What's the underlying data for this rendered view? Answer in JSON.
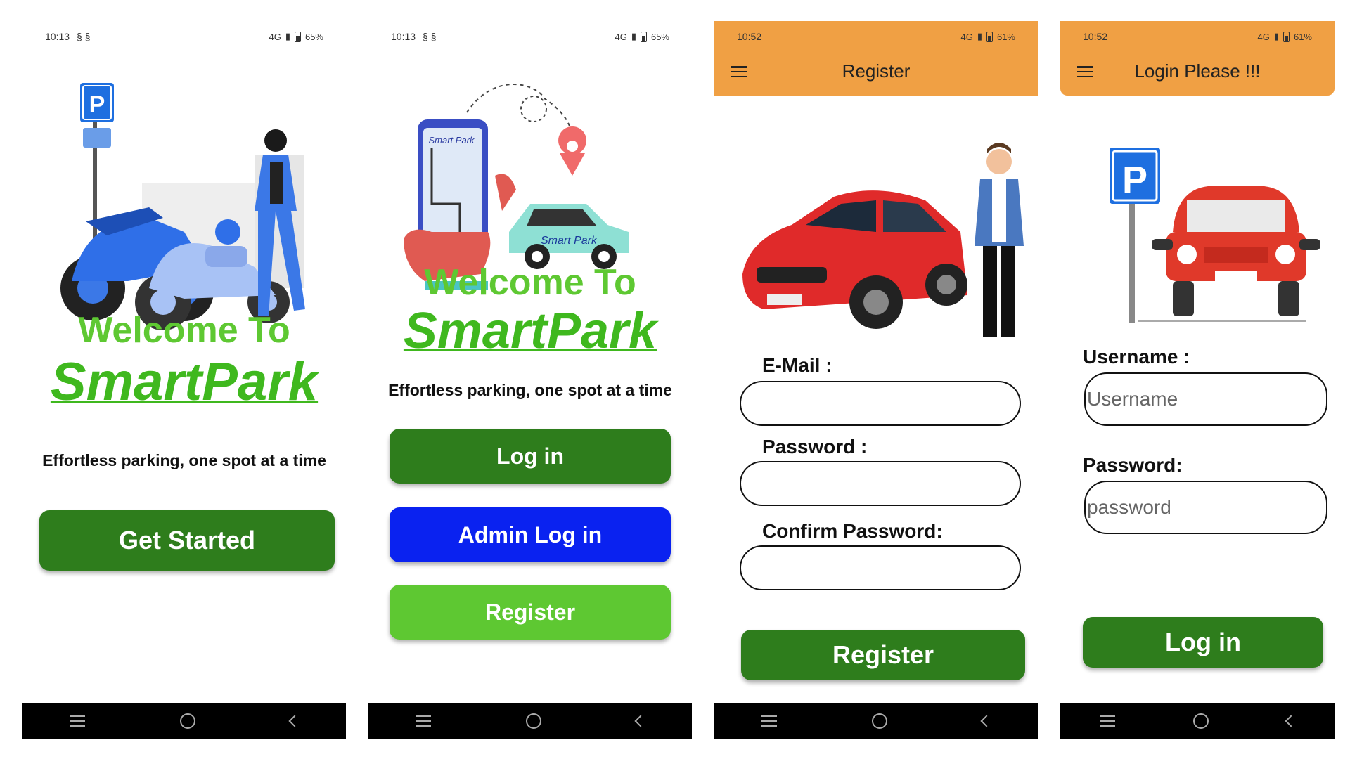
{
  "screens": {
    "welcome": {
      "status": {
        "time": "10:13",
        "right": "4G",
        "battery": "65%"
      },
      "welcome_text": "Welcome To",
      "brand": "SmartPark",
      "tagline": "Effortless parking, one spot at a time",
      "get_started": "Get Started",
      "parking_sign": "P"
    },
    "menu": {
      "status": {
        "time": "10:13",
        "right": "4G",
        "battery": "65%"
      },
      "welcome_text": "Welcome To",
      "brand": "SmartPark",
      "tagline": "Effortless parking, one spot at a time",
      "login": "Log in",
      "admin_login": "Admin Log in",
      "register": "Register",
      "phone_label": "Smart Park",
      "car_label": "Smart Park"
    },
    "register": {
      "status": {
        "time": "10:52",
        "right": "4G",
        "battery": "61%"
      },
      "title": "Register",
      "email_label": "E-Mail :",
      "password_label": "Password :",
      "confirm_label": "Confirm Password:",
      "register_button": "Register"
    },
    "login": {
      "status": {
        "time": "10:52",
        "right": "4G",
        "battery": "61%"
      },
      "title": "Login Please !!!",
      "username_label": "Username :",
      "username_placeholder": "Username",
      "password_label": "Password:",
      "password_placeholder": "password",
      "login_button": "Log in",
      "parking_sign": "P"
    }
  },
  "colors": {
    "appbar": "#f0a044",
    "primary_green": "#2e7d1c",
    "brand_green": "#5ec832",
    "admin_blue": "#0a22f0"
  }
}
